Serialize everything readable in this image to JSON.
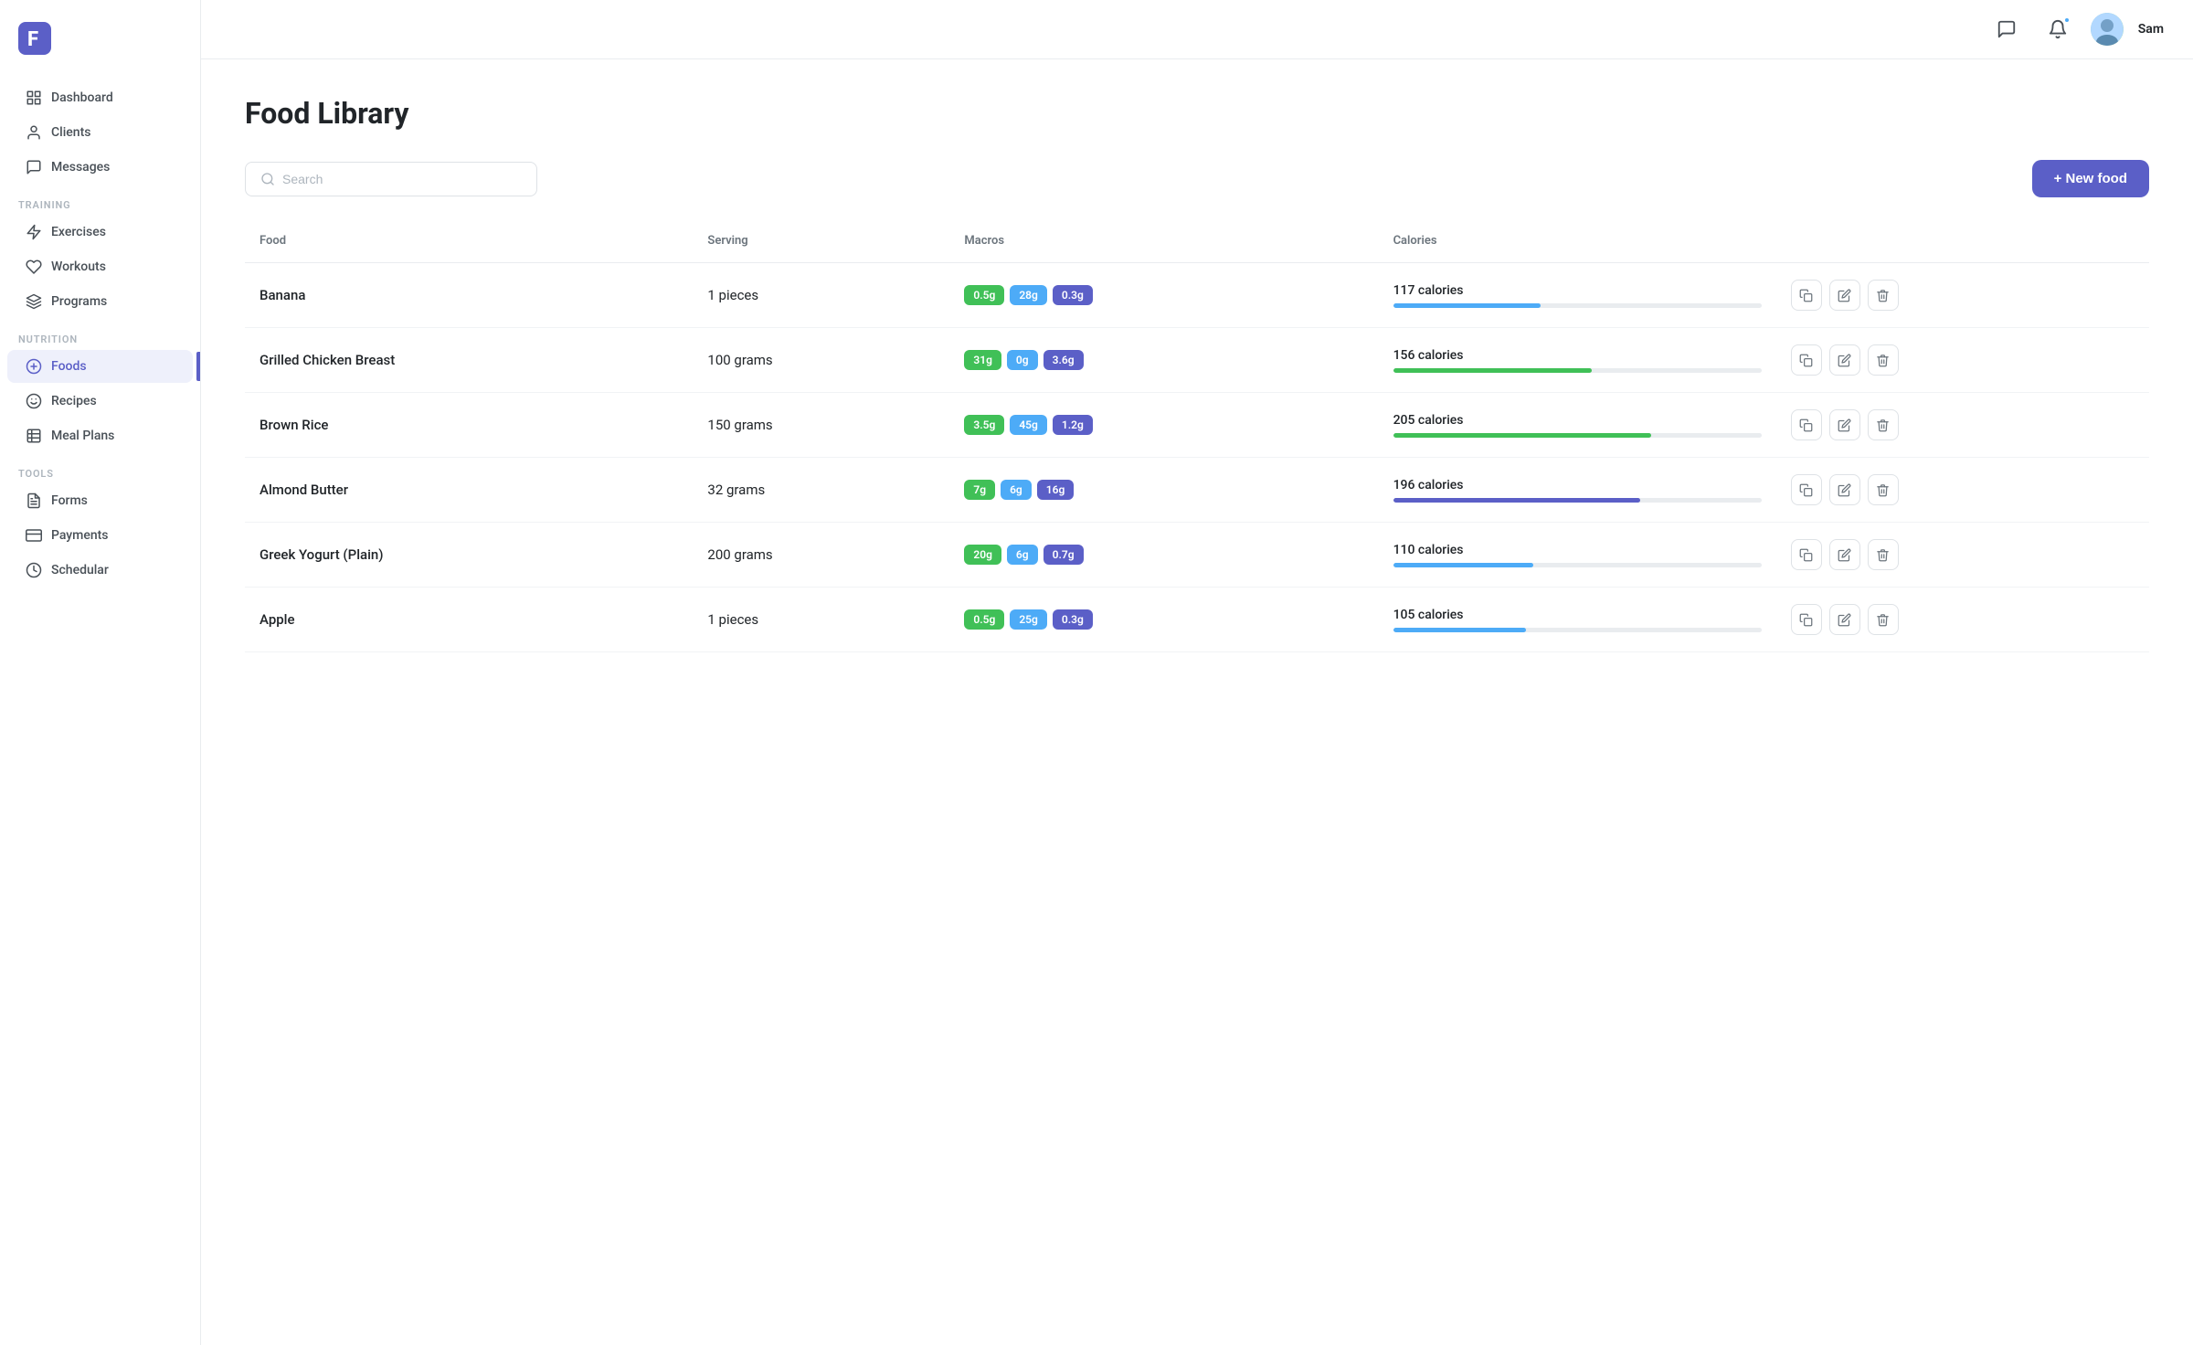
{
  "app": {
    "logo_letter": "F",
    "user_name": "Sam"
  },
  "sidebar": {
    "section_main": "",
    "section_training": "Training",
    "section_nutrition": "Nutrition",
    "section_tools": "Tools",
    "items_main": [
      {
        "id": "dashboard",
        "label": "Dashboard",
        "icon": "dashboard-icon",
        "active": false
      },
      {
        "id": "clients",
        "label": "Clients",
        "icon": "clients-icon",
        "active": false
      },
      {
        "id": "messages",
        "label": "Messages",
        "icon": "messages-icon",
        "active": false
      }
    ],
    "items_training": [
      {
        "id": "exercises",
        "label": "Exercises",
        "icon": "exercises-icon",
        "active": false
      },
      {
        "id": "workouts",
        "label": "Workouts",
        "icon": "workouts-icon",
        "active": false
      },
      {
        "id": "programs",
        "label": "Programs",
        "icon": "programs-icon",
        "active": false
      }
    ],
    "items_nutrition": [
      {
        "id": "foods",
        "label": "Foods",
        "icon": "foods-icon",
        "active": true
      },
      {
        "id": "recipes",
        "label": "Recipes",
        "icon": "recipes-icon",
        "active": false
      },
      {
        "id": "meal-plans",
        "label": "Meal Plans",
        "icon": "meal-plans-icon",
        "active": false
      }
    ],
    "items_tools": [
      {
        "id": "forms",
        "label": "Forms",
        "icon": "forms-icon",
        "active": false
      },
      {
        "id": "payments",
        "label": "Payments",
        "icon": "payments-icon",
        "active": false
      },
      {
        "id": "schedular",
        "label": "Schedular",
        "icon": "schedular-icon",
        "active": false
      }
    ]
  },
  "header": {
    "chat_label": "Chat",
    "notifications_label": "Notifications",
    "user_name": "Sam"
  },
  "page": {
    "title": "Food Library",
    "search_placeholder": "Search",
    "new_food_button": "+ New food"
  },
  "table": {
    "col_food": "Food",
    "col_serving": "Serving",
    "col_macros": "Macros",
    "col_calories": "Calories",
    "rows": [
      {
        "name": "Banana",
        "serving": "1 pieces",
        "protein": "0.5g",
        "carbs": "28g",
        "fat": "0.3g",
        "calories": "117 calories",
        "calories_pct": 40,
        "bar_color": "#4dabf7"
      },
      {
        "name": "Grilled Chicken Breast",
        "serving": "100 grams",
        "protein": "31g",
        "carbs": "0g",
        "fat": "3.6g",
        "calories": "156 calories",
        "calories_pct": 54,
        "bar_color": "#40c057"
      },
      {
        "name": "Brown Rice",
        "serving": "150 grams",
        "protein": "3.5g",
        "carbs": "45g",
        "fat": "1.2g",
        "calories": "205 calories",
        "calories_pct": 70,
        "bar_color": "#40c057"
      },
      {
        "name": "Almond Butter",
        "serving": "32 grams",
        "protein": "7g",
        "carbs": "6g",
        "fat": "16g",
        "calories": "196 calories",
        "calories_pct": 67,
        "bar_color": "#5b5fc7"
      },
      {
        "name": "Greek Yogurt (Plain)",
        "serving": "200 grams",
        "protein": "20g",
        "carbs": "6g",
        "fat": "0.7g",
        "calories": "110 calories",
        "calories_pct": 38,
        "bar_color": "#4dabf7"
      },
      {
        "name": "Apple",
        "serving": "1 pieces",
        "protein": "0.5g",
        "carbs": "25g",
        "fat": "0.3g",
        "calories": "105 calories",
        "calories_pct": 36,
        "bar_color": "#4dabf7"
      }
    ]
  }
}
